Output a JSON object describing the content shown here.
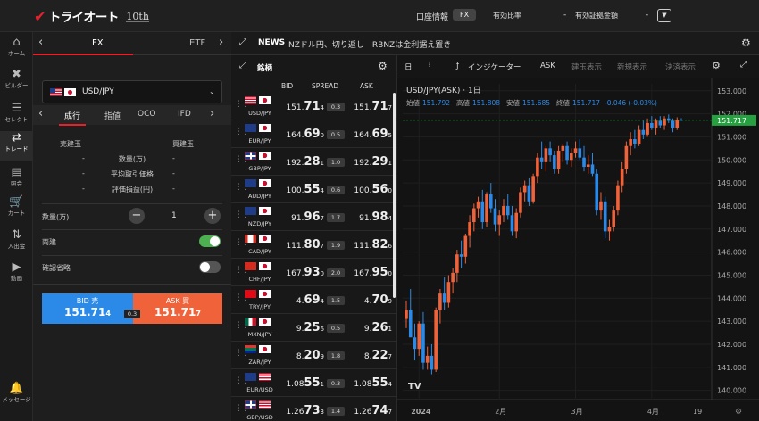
{
  "brand": {
    "logo_text": "トライオート",
    "anniversary": "10th"
  },
  "topbar": {
    "account_info": "口座情報",
    "account_type": "FX",
    "margin_ratio_label": "有効比率",
    "margin_ratio_value": "-",
    "equity_label": "有効証拠金額",
    "equity_value": "-"
  },
  "sidenav": [
    {
      "label": "ホーム",
      "icon": "home-icon",
      "glyph": "⌂"
    },
    {
      "label": "ビルダー",
      "icon": "tools-icon",
      "glyph": "✖"
    },
    {
      "label": "セレクト",
      "icon": "stack-icon",
      "glyph": "☰"
    },
    {
      "label": "トレード",
      "icon": "trade-icon",
      "glyph": "⇄"
    },
    {
      "label": "照会",
      "icon": "list-icon",
      "glyph": "▤"
    },
    {
      "label": "カート",
      "icon": "cart-icon",
      "glyph": "🛒"
    },
    {
      "label": "入出金",
      "icon": "transfer-icon",
      "glyph": "⇅"
    },
    {
      "label": "動画",
      "icon": "video-icon",
      "glyph": "▶"
    },
    {
      "label": "メッセージ",
      "icon": "bell-icon",
      "glyph": "🔔"
    }
  ],
  "fxpanel": {
    "tabs": [
      "FX",
      "ETF"
    ],
    "pair": "USD/JPY",
    "order_tabs": [
      "成行",
      "指値",
      "OCO",
      "IFD"
    ],
    "sell_label": "売建玉",
    "buy_label": "買建玉",
    "rows": [
      {
        "label": "数量(万)",
        "sell": "-",
        "buy": "-"
      },
      {
        "label": "平均取引価格",
        "sell": "-",
        "buy": "-"
      },
      {
        "label": "評価損益(円)",
        "sell": "-",
        "buy": "-"
      }
    ],
    "qty_label": "数量(万)",
    "qty_value": "1",
    "hedge_label": "両建",
    "hedge_on": true,
    "skip_confirm_label": "確認省略",
    "skip_confirm_on": false,
    "bid_label": "BID 売",
    "bid_head": "151.71",
    "bid_tail": "4",
    "ask_label": "ASK 買",
    "ask_head": "151.71",
    "ask_tail": "7",
    "spread": "0.3"
  },
  "news": {
    "label": "NEWS",
    "headline": "NZドル円、切り返し　RBNZは金利据え置き"
  },
  "rates": {
    "title": "銘柄",
    "col_bid": "BID",
    "col_spread": "SPREAD",
    "col_ask": "ASK",
    "rows": [
      {
        "pair": "USD/JPY",
        "f1": "us",
        "f2": "jp",
        "bid_head": "151.",
        "bid_big": "71",
        "bid_tail": "4",
        "spread": "0.3",
        "ask_head": "151.",
        "ask_big": "71",
        "ask_tail": "7"
      },
      {
        "pair": "EUR/JPY",
        "f1": "eu",
        "f2": "jp",
        "bid_head": "164.",
        "bid_big": "69",
        "bid_tail": "0",
        "spread": "0.5",
        "ask_head": "164.",
        "ask_big": "69",
        "ask_tail": "5"
      },
      {
        "pair": "GBP/JPY",
        "f1": "gb",
        "f2": "jp",
        "bid_head": "192.",
        "bid_big": "28",
        "bid_tail": "1",
        "spread": "1.0",
        "ask_head": "192.",
        "ask_big": "29",
        "ask_tail": "1"
      },
      {
        "pair": "AUD/JPY",
        "f1": "au",
        "f2": "jp",
        "bid_head": "100.",
        "bid_big": "55",
        "bid_tail": "4",
        "spread": "0.6",
        "ask_head": "100.",
        "ask_big": "56",
        "ask_tail": "0"
      },
      {
        "pair": "NZD/JPY",
        "f1": "nz",
        "f2": "jp",
        "bid_head": "91.",
        "bid_big": "96",
        "bid_tail": "7",
        "spread": "1.7",
        "ask_head": "91.",
        "ask_big": "98",
        "ask_tail": "4"
      },
      {
        "pair": "CAD/JPY",
        "f1": "ca",
        "f2": "jp",
        "bid_head": "111.",
        "bid_big": "80",
        "bid_tail": "7",
        "spread": "1.9",
        "ask_head": "111.",
        "ask_big": "82",
        "ask_tail": "6"
      },
      {
        "pair": "CHF/JPY",
        "f1": "ch",
        "f2": "jp",
        "bid_head": "167.",
        "bid_big": "93",
        "bid_tail": "0",
        "spread": "2.0",
        "ask_head": "167.",
        "ask_big": "95",
        "ask_tail": "0"
      },
      {
        "pair": "TRY/JPY",
        "f1": "tr",
        "f2": "jp",
        "bid_head": "4.",
        "bid_big": "69",
        "bid_tail": "4",
        "spread": "1.5",
        "ask_head": "4.",
        "ask_big": "70",
        "ask_tail": "9"
      },
      {
        "pair": "MXN/JPY",
        "f1": "mx",
        "f2": "jp",
        "bid_head": "9.",
        "bid_big": "25",
        "bid_tail": "6",
        "spread": "0.5",
        "ask_head": "9.",
        "ask_big": "26",
        "ask_tail": "1"
      },
      {
        "pair": "ZAR/JPY",
        "f1": "za",
        "f2": "jp",
        "bid_head": "8.",
        "bid_big": "20",
        "bid_tail": "9",
        "spread": "1.8",
        "ask_head": "8.",
        "ask_big": "22",
        "ask_tail": "7"
      },
      {
        "pair": "EUR/USD",
        "f1": "eu",
        "f2": "us",
        "bid_head": "1.08",
        "bid_big": "55",
        "bid_tail": "1",
        "spread": "0.3",
        "ask_head": "1.08",
        "ask_big": "55",
        "ask_tail": "4"
      },
      {
        "pair": "GBP/USD",
        "f1": "gb",
        "f2": "us",
        "bid_head": "1.26",
        "bid_big": "73",
        "bid_tail": "3",
        "spread": "1.4",
        "ask_head": "1.26",
        "ask_big": "74",
        "ask_tail": "7"
      }
    ]
  },
  "chart_toolbar": {
    "interval": "日",
    "indicator": "インジケーター",
    "ask": "ASK",
    "btn1": "建玉表示",
    "btn2": "新規表示",
    "btn3": "決済表示"
  },
  "chart_data": {
    "type": "candlestick",
    "title": "USD/JPY(ASK) · 1日",
    "ohlc_label": {
      "open_label": "始値",
      "open": "151.792",
      "high_label": "高値",
      "high": "151.808",
      "low_label": "安値",
      "low": "151.685",
      "close_label": "終値",
      "close": "151.717",
      "change": "-0.046 (-0.03%)"
    },
    "ylim": [
      139.6,
      153.3
    ],
    "y_ticks": [
      "153.000",
      "152.000",
      "151.000",
      "150.000",
      "149.000",
      "148.000",
      "147.000",
      "146.000",
      "145.000",
      "144.000",
      "143.000",
      "142.000",
      "141.000",
      "140.000"
    ],
    "x_ticks": [
      "2024",
      "2月",
      "3月",
      "4月",
      "19"
    ],
    "last_price": "151.717",
    "colors": {
      "up": "#f0623a",
      "down": "#2b8ae8",
      "last": "#26a041"
    },
    "candles": [
      [
        143.1,
        143.9,
        142.7,
        143.5
      ],
      [
        143.5,
        144.4,
        142.9,
        142.3
      ],
      [
        142.3,
        142.9,
        141.3,
        141.8
      ],
      [
        141.8,
        143.0,
        141.5,
        142.9
      ],
      [
        142.9,
        143.4,
        140.9,
        141.2
      ],
      [
        141.2,
        141.9,
        140.9,
        141.5
      ],
      [
        141.5,
        142.0,
        140.7,
        140.9
      ],
      [
        140.9,
        143.6,
        140.8,
        143.5
      ],
      [
        143.5,
        144.4,
        142.9,
        144.2
      ],
      [
        144.2,
        144.9,
        143.5,
        143.8
      ],
      [
        143.8,
        145.0,
        143.6,
        144.7
      ],
      [
        144.7,
        145.3,
        144.2,
        145.1
      ],
      [
        145.1,
        146.1,
        144.7,
        145.9
      ],
      [
        145.9,
        146.5,
        145.3,
        145.8
      ],
      [
        145.8,
        146.8,
        145.5,
        146.7
      ],
      [
        146.7,
        147.6,
        146.2,
        147.3
      ],
      [
        147.3,
        148.1,
        146.9,
        147.9
      ],
      [
        147.9,
        148.4,
        147.5,
        148.2
      ],
      [
        148.2,
        148.7,
        147.0,
        147.3
      ],
      [
        147.3,
        148.6,
        147.1,
        148.5
      ],
      [
        148.5,
        149.0,
        147.7,
        147.9
      ],
      [
        147.9,
        148.3,
        146.9,
        147.2
      ],
      [
        147.2,
        147.8,
        146.7,
        147.6
      ],
      [
        147.6,
        148.3,
        147.3,
        148.0
      ],
      [
        148.0,
        148.5,
        147.4,
        147.6
      ],
      [
        147.6,
        148.0,
        146.7,
        146.9
      ],
      [
        146.9,
        147.9,
        146.6,
        147.7
      ],
      [
        147.7,
        148.8,
        147.5,
        148.6
      ],
      [
        148.6,
        149.1,
        148.2,
        148.9
      ],
      [
        148.9,
        149.2,
        148.0,
        148.2
      ],
      [
        148.2,
        149.4,
        148.1,
        149.3
      ],
      [
        149.3,
        150.3,
        149.0,
        150.1
      ],
      [
        150.1,
        150.8,
        149.6,
        149.9
      ],
      [
        149.9,
        150.6,
        149.5,
        150.5
      ],
      [
        150.5,
        150.8,
        149.9,
        150.2
      ],
      [
        150.2,
        150.4,
        149.4,
        149.6
      ],
      [
        149.6,
        150.6,
        149.4,
        150.4
      ],
      [
        150.4,
        150.7,
        149.9,
        150.6
      ],
      [
        150.6,
        150.8,
        149.8,
        150.0
      ],
      [
        150.0,
        150.5,
        149.7,
        150.3
      ],
      [
        150.3,
        150.8,
        150.1,
        150.5
      ],
      [
        150.5,
        150.9,
        150.0,
        150.1
      ],
      [
        150.1,
        150.6,
        149.5,
        149.7
      ],
      [
        149.7,
        150.2,
        149.4,
        149.8
      ],
      [
        149.8,
        150.3,
        149.3,
        149.4
      ],
      [
        149.4,
        149.6,
        147.6,
        147.8
      ],
      [
        147.8,
        148.6,
        147.4,
        148.2
      ],
      [
        148.2,
        148.4,
        146.6,
        146.9
      ],
      [
        146.9,
        147.4,
        146.5,
        147.1
      ],
      [
        147.1,
        148.0,
        146.9,
        147.8
      ],
      [
        147.8,
        149.1,
        147.6,
        148.9
      ],
      [
        148.9,
        149.9,
        148.6,
        149.6
      ],
      [
        149.6,
        150.8,
        149.4,
        150.6
      ],
      [
        150.6,
        151.2,
        150.2,
        150.9
      ],
      [
        150.9,
        151.3,
        150.5,
        150.7
      ],
      [
        150.7,
        151.5,
        150.6,
        151.3
      ],
      [
        151.3,
        151.7,
        150.9,
        151.1
      ],
      [
        151.1,
        151.8,
        151.0,
        151.6
      ],
      [
        151.6,
        151.9,
        151.3,
        151.4
      ],
      [
        151.4,
        151.8,
        151.1,
        151.7
      ],
      [
        151.7,
        151.9,
        151.4,
        151.5
      ],
      [
        151.5,
        151.9,
        151.3,
        151.8
      ],
      [
        151.8,
        151.97,
        151.6,
        151.7
      ],
      [
        151.7,
        151.8,
        151.2,
        151.4
      ],
      [
        151.4,
        151.85,
        151.3,
        151.75
      ],
      [
        151.75,
        151.81,
        151.69,
        151.72
      ]
    ]
  }
}
